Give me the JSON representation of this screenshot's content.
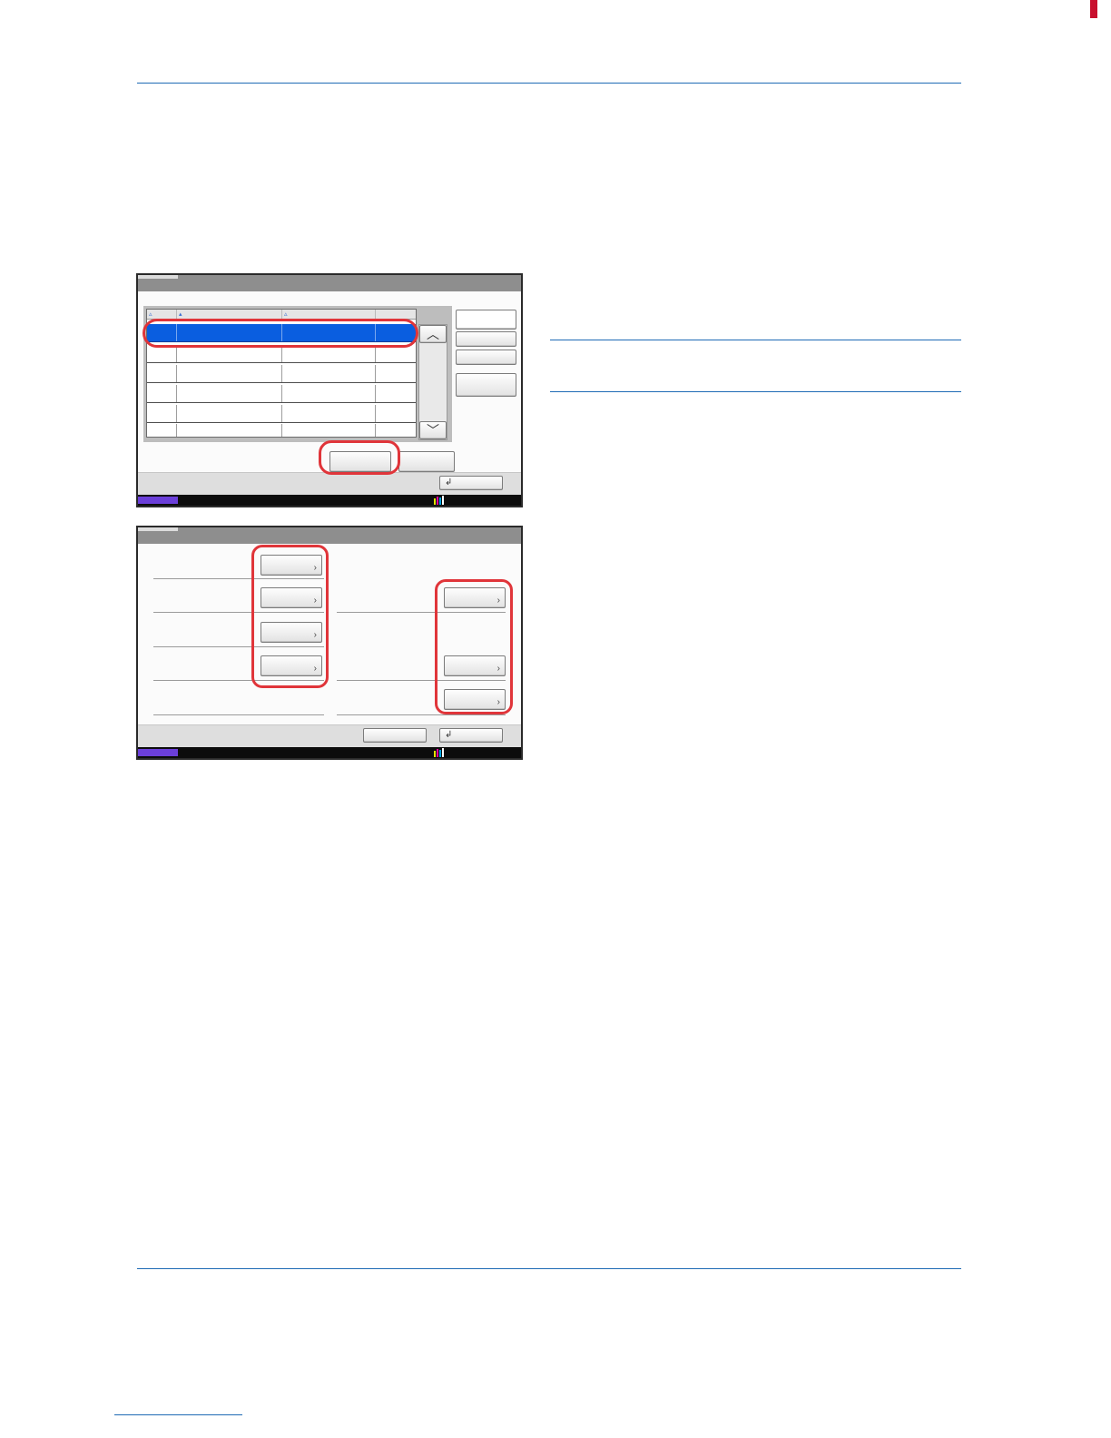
{
  "page": {
    "accent_color": "#1f6bb5",
    "marker_color": "#c8102e",
    "highlight_color": "#e0353a"
  },
  "panel_list": {
    "selected_row_color": "#0a5ee0",
    "scroll_up_icon": "chevron-up-icon",
    "scroll_down_icon": "chevron-down-icon",
    "return_icon": "return-icon"
  },
  "panel_detail": {
    "chevron_icon": "chevron-right-icon",
    "return_icon": "return-icon"
  }
}
